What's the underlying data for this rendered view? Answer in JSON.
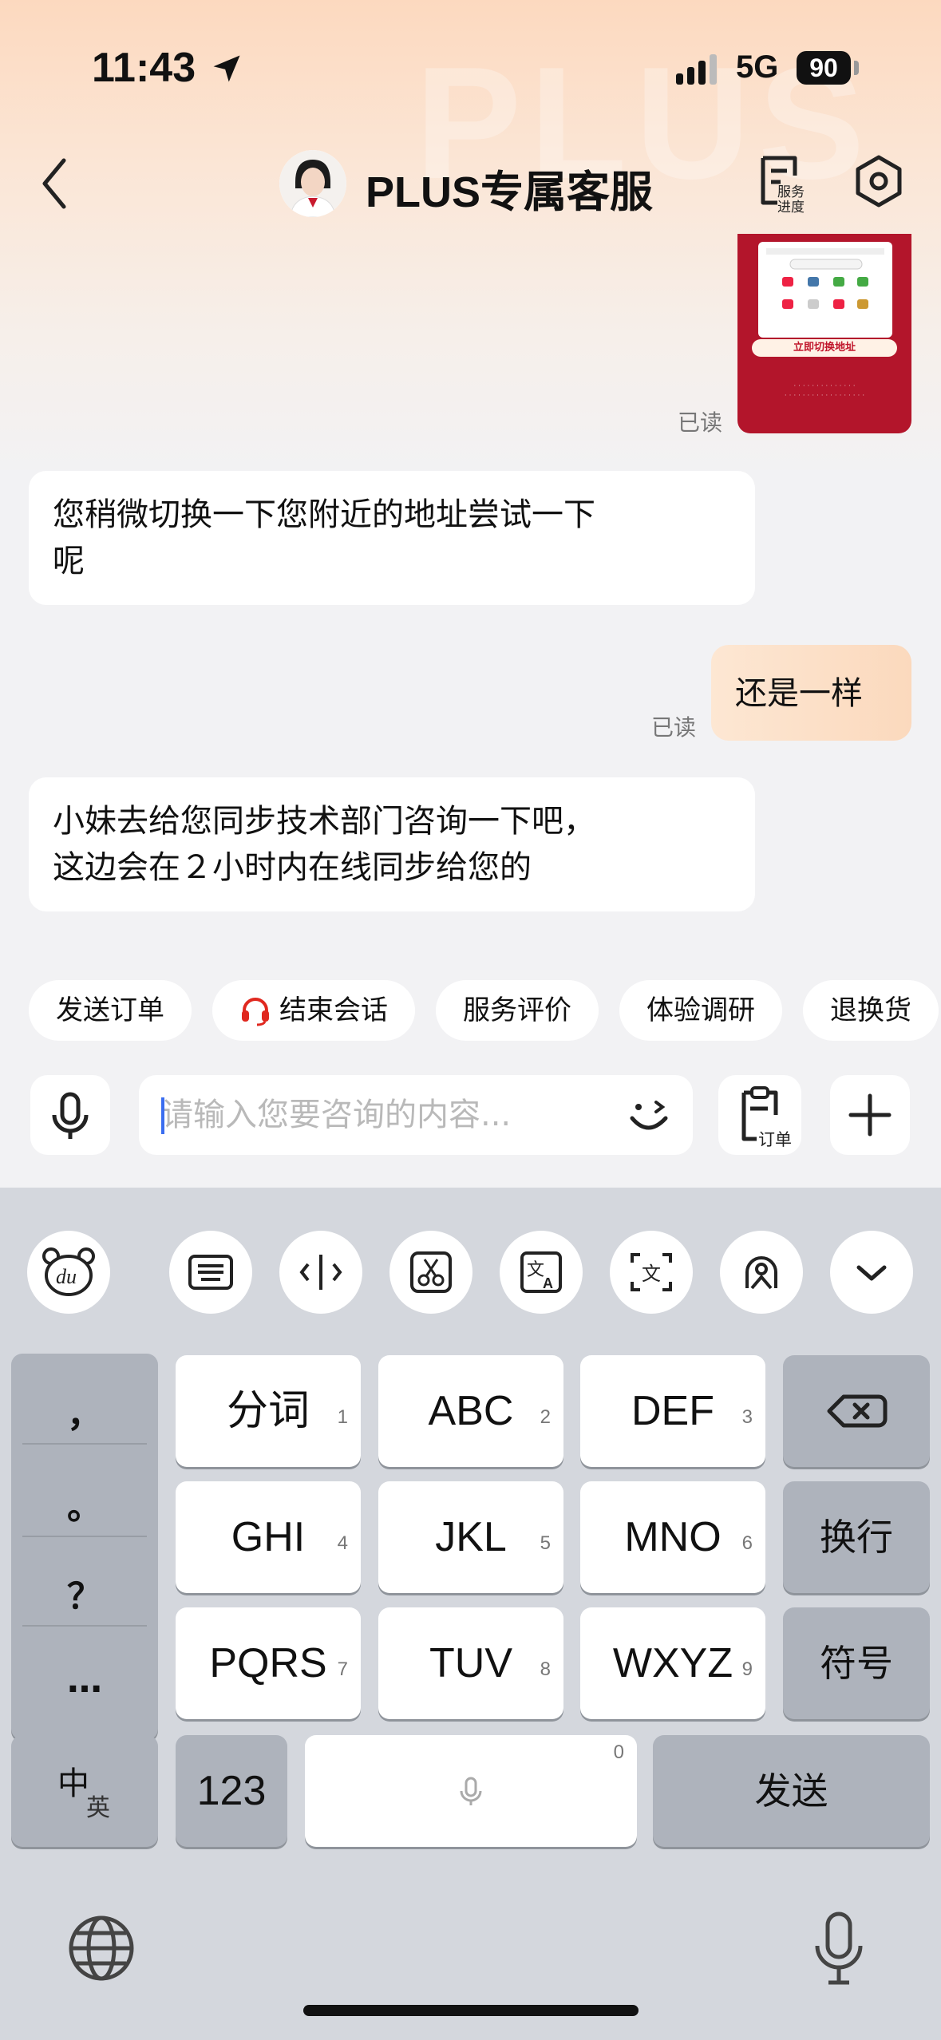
{
  "status_bar": {
    "time": "11:43",
    "network": "5G",
    "battery": "90"
  },
  "header": {
    "title": "PLUS专属客服",
    "watermark": "PLUS",
    "progress_label_line1": "服务",
    "progress_label_line2": "进度"
  },
  "image_message": {
    "button_label": "立即切换地址",
    "read_label": "已读"
  },
  "messages": [
    {
      "side": "left",
      "lines": [
        "您稍微切换一下您附近的地址尝试一下",
        "呢"
      ]
    },
    {
      "side": "right",
      "text": "还是一样",
      "read_label": "已读"
    },
    {
      "side": "left",
      "lines": [
        "小妹去给您同步技术部门咨询一下吧，",
        "这边会在２小时内在线同步给您的"
      ]
    }
  ],
  "quick_actions": [
    "发送订单",
    "结束会话",
    "服务评价",
    "体验调研",
    "退换货"
  ],
  "input": {
    "placeholder": "请输入您要咨询的内容...",
    "order_label": "订单"
  },
  "keyboard": {
    "toolbar_icons": [
      "du-bear-icon",
      "keyboard-icon",
      "cursor-move-icon",
      "clipboard-scissors-icon",
      "translate-icon",
      "ocr-text-icon",
      "handwriting-icon",
      "collapse-chevron-icon"
    ],
    "punctuation": [
      "，",
      "。",
      "？",
      "…"
    ],
    "rows": [
      [
        {
          "label": "分词",
          "num": "1"
        },
        {
          "label": "ABC",
          "num": "2"
        },
        {
          "label": "DEF",
          "num": "3"
        }
      ],
      [
        {
          "label": "GHI",
          "num": "4"
        },
        {
          "label": "JKL",
          "num": "5"
        },
        {
          "label": "MNO",
          "num": "6"
        }
      ],
      [
        {
          "label": "PQRS",
          "num": "7"
        },
        {
          "label": "TUV",
          "num": "8"
        },
        {
          "label": "WXYZ",
          "num": "9"
        }
      ]
    ],
    "right_keys": {
      "newline": "换行",
      "symbols": "符号"
    },
    "bottom": {
      "lang_main": "中",
      "lang_sub": "英",
      "numbers": "123",
      "space_num": "0",
      "send": "发送"
    }
  }
}
